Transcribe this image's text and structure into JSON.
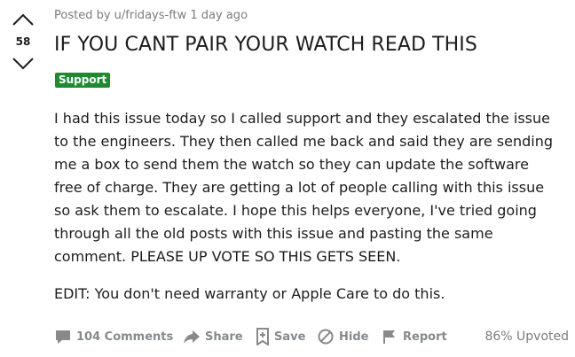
{
  "vote": {
    "count": "58"
  },
  "post": {
    "meta": "Posted by u/fridays-ftw 1 day ago",
    "title": "IF YOU CANT PAIR YOUR WATCH READ THIS",
    "flair": "Support",
    "body_lines": [
      "I had this issue today so I called support and they escalated the issue",
      "to the engineers. They then called me back and said they are sending",
      "me a box to send them the watch so they can update the software",
      "free of charge. They are getting a lot of people calling with this issue",
      "so ask them to escalate. I hope this helps everyone, I've tried going",
      "through all the old posts with this issue and pasting the same",
      "comment. PLEASE UP VOTE SO THIS GETS SEEN."
    ],
    "edit": "EDIT: You don't need warranty or Apple Care to do this."
  },
  "actions": {
    "comments": "104 Comments",
    "share": "Share",
    "save": "Save",
    "hide": "Hide",
    "report": "Report",
    "upvoted": "86% Upvoted"
  },
  "colors": {
    "flair_bg": "#1e8a32",
    "text": "#1c1c1c",
    "muted": "#7c7c7c",
    "action": "#878a8c"
  },
  "icons": {
    "upvote": "chevron-up-icon",
    "downvote": "chevron-down-icon",
    "comments": "comment-icon",
    "share": "share-arrow-icon",
    "save": "bookmark-plus-icon",
    "hide": "hide-circle-icon",
    "report": "flag-icon"
  }
}
